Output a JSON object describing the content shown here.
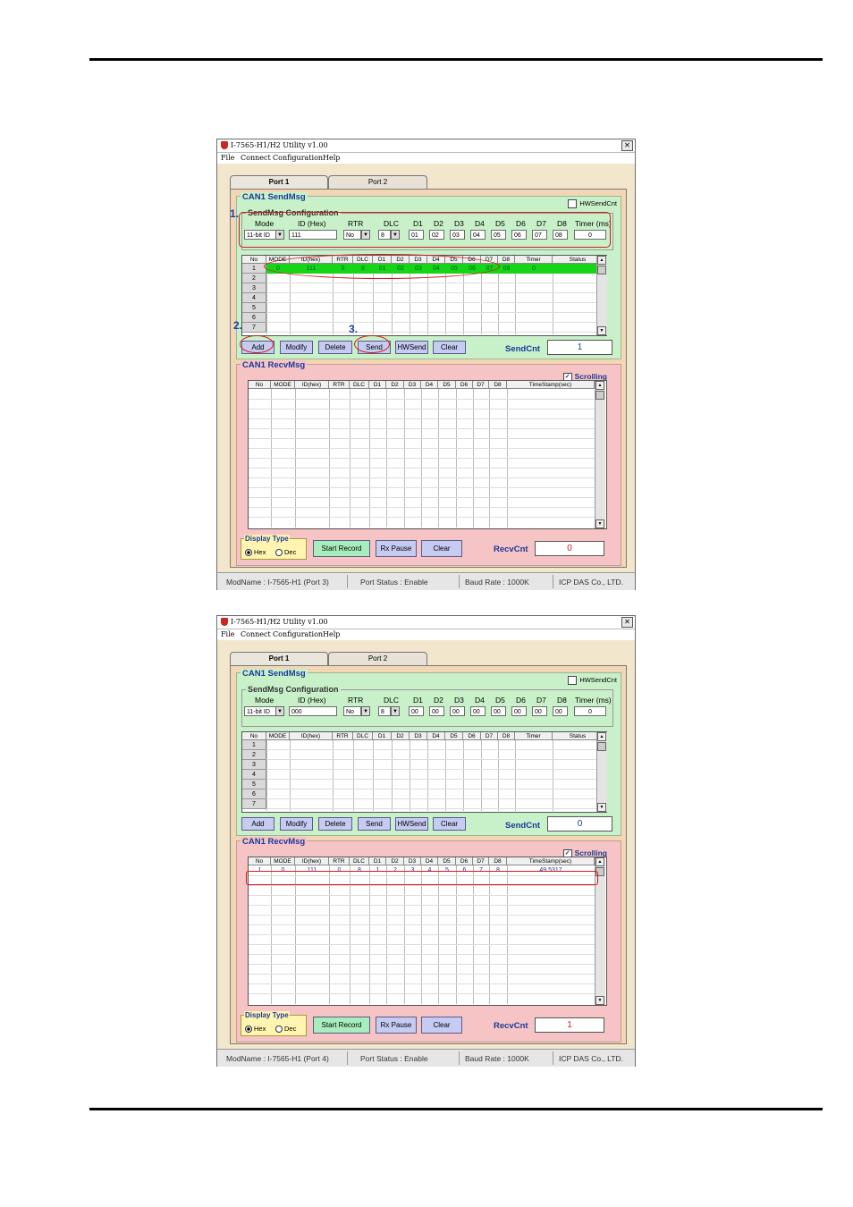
{
  "windows": [
    {
      "title": "I-7565-H1/H2 Utility v1.00",
      "close_glyph": "✕",
      "menu": [
        "File",
        "Connect",
        "Configuration",
        "Help"
      ],
      "tabs": [
        "Port 1",
        "Port 2"
      ],
      "send": {
        "title": "CAN1 SendMsg",
        "hwsendcnt_label": "HWSendCnt",
        "config_title": "SendMsg Configuration",
        "labels": [
          "Mode",
          "ID (Hex)",
          "RTR",
          "DLC",
          "D1",
          "D2",
          "D3",
          "D4",
          "D5",
          "D6",
          "D7",
          "D8",
          "Timer (ms)"
        ],
        "values": {
          "mode": "11-bit ID",
          "id": "111",
          "rtr": "No",
          "dlc": "8",
          "d": [
            "01",
            "02",
            "03",
            "04",
            "05",
            "06",
            "07",
            "08"
          ],
          "timer": "0"
        },
        "headers": [
          "No",
          "MODE",
          "ID(hex)",
          "RTR",
          "DLC",
          "D1",
          "D2",
          "D3",
          "D4",
          "D5",
          "D6",
          "D7",
          "D8",
          "Timer",
          "Status"
        ],
        "rows": [
          [
            "0",
            "111",
            "0",
            "8",
            "01",
            "02",
            "03",
            "04",
            "05",
            "06",
            "07",
            "08",
            "0",
            ""
          ]
        ],
        "row_nums": [
          "1",
          "2",
          "3",
          "4",
          "5",
          "6",
          "7"
        ],
        "buttons": [
          "Add",
          "Modify",
          "Delete",
          "Send",
          "HWSend",
          "Clear"
        ],
        "cnt_label": "SendCnt",
        "cnt": "1"
      },
      "recv": {
        "title": "CAN1 RecvMsg",
        "scrolling_label": "Scrolling",
        "headers": [
          "No",
          "MODE",
          "ID(hex)",
          "RTR",
          "DLC",
          "D1",
          "D2",
          "D3",
          "D4",
          "D5",
          "D6",
          "D7",
          "D8",
          "TimeStamp(sec)"
        ],
        "rows": [],
        "display_type": "Display Type",
        "hex": "Hex",
        "dec": "Dec",
        "buttons": [
          "Start Record",
          "Rx Pause",
          "Clear"
        ],
        "cnt_label": "RecvCnt",
        "cnt": "0"
      },
      "status": [
        "ModName : I-7565-H1 (Port 3)",
        "Port Status : Enable",
        "Baud Rate : 1000K",
        "ICP DAS Co., LTD."
      ],
      "annotations": [
        "1.",
        "2.",
        "3."
      ]
    },
    {
      "title": "I-7565-H1/H2 Utility v1.00",
      "close_glyph": "✕",
      "menu": [
        "File",
        "Connect",
        "Configuration",
        "Help"
      ],
      "tabs": [
        "Port 1",
        "Port 2"
      ],
      "send": {
        "title": "CAN1 SendMsg",
        "hwsendcnt_label": "HWSendCnt",
        "config_title": "SendMsg Configuration",
        "labels": [
          "Mode",
          "ID (Hex)",
          "RTR",
          "DLC",
          "D1",
          "D2",
          "D3",
          "D4",
          "D5",
          "D6",
          "D7",
          "D8",
          "Timer (ms)"
        ],
        "values": {
          "mode": "11-bit ID",
          "id": "000",
          "rtr": "No",
          "dlc": "8",
          "d": [
            "00",
            "00",
            "00",
            "00",
            "00",
            "00",
            "00",
            "00"
          ],
          "timer": "0"
        },
        "headers": [
          "No",
          "MODE",
          "ID(hex)",
          "RTR",
          "DLC",
          "D1",
          "D2",
          "D3",
          "D4",
          "D5",
          "D6",
          "D7",
          "D8",
          "Timer",
          "Status"
        ],
        "rows": [],
        "row_nums": [
          "1",
          "2",
          "3",
          "4",
          "5",
          "6",
          "7"
        ],
        "buttons": [
          "Add",
          "Modify",
          "Delete",
          "Send",
          "HWSend",
          "Clear"
        ],
        "cnt_label": "SendCnt",
        "cnt": "0"
      },
      "recv": {
        "title": "CAN1 RecvMsg",
        "scrolling_label": "Scrolling",
        "headers": [
          "No",
          "MODE",
          "ID(hex)",
          "RTR",
          "DLC",
          "D1",
          "D2",
          "D3",
          "D4",
          "D5",
          "D6",
          "D7",
          "D8",
          "TimeStamp(sec)"
        ],
        "rows": [
          [
            "1",
            "0",
            "111",
            "0",
            "8",
            "1",
            "2",
            "3",
            "4",
            "5",
            "6",
            "7",
            "8",
            "49.5317"
          ]
        ],
        "display_type": "Display Type",
        "hex": "Hex",
        "dec": "Dec",
        "buttons": [
          "Start Record",
          "Rx Pause",
          "Clear"
        ],
        "cnt_label": "RecvCnt",
        "cnt": "1"
      },
      "status": [
        "ModName : I-7565-H1 (Port 4)",
        "Port Status : Enable",
        "Baud Rate : 1000K",
        "ICP DAS Co., LTD."
      ],
      "annotations": []
    }
  ]
}
